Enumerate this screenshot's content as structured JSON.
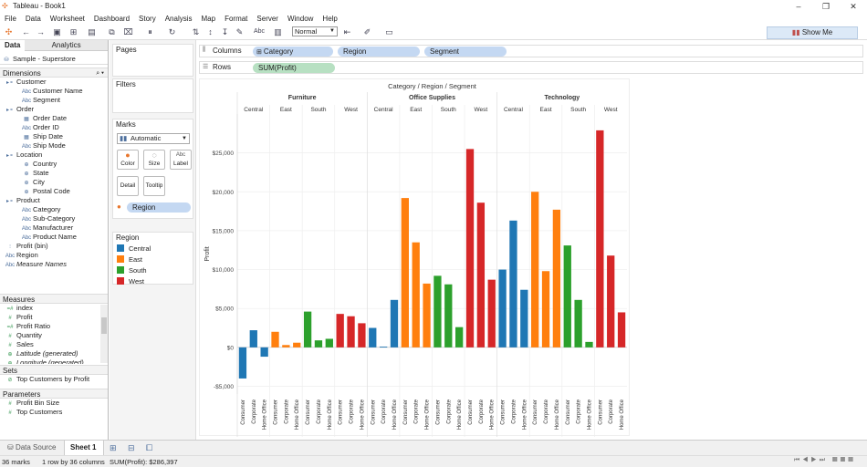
{
  "window": {
    "title": "Tableau - Book1"
  },
  "menu": [
    "File",
    "Data",
    "Worksheet",
    "Dashboard",
    "Story",
    "Analysis",
    "Map",
    "Format",
    "Server",
    "Window",
    "Help"
  ],
  "toolbar": {
    "format_select": "Normal",
    "show_me": "Show Me"
  },
  "left_pane": {
    "tabs": [
      "Data",
      "Analytics"
    ],
    "datasource": "Sample - Superstore",
    "dimensions_title": "Dimensions",
    "dimensions": [
      {
        "label": "Customer",
        "type": "folder",
        "indent": 0
      },
      {
        "label": "Customer Name",
        "type": "Abc",
        "indent": 1
      },
      {
        "label": "Segment",
        "type": "Abc",
        "indent": 1
      },
      {
        "label": "Order",
        "type": "folder",
        "indent": 0
      },
      {
        "label": "Order Date",
        "type": "date",
        "indent": 1
      },
      {
        "label": "Order ID",
        "type": "Abc",
        "indent": 1
      },
      {
        "label": "Ship Date",
        "type": "date",
        "indent": 1
      },
      {
        "label": "Ship Mode",
        "type": "Abc",
        "indent": 1
      },
      {
        "label": "Location",
        "type": "folder",
        "indent": 0
      },
      {
        "label": "Country",
        "type": "geo",
        "indent": 1
      },
      {
        "label": "State",
        "type": "geo",
        "indent": 1
      },
      {
        "label": "City",
        "type": "geo",
        "indent": 1
      },
      {
        "label": "Postal Code",
        "type": "geo",
        "indent": 1
      },
      {
        "label": "Product",
        "type": "folder",
        "indent": 0
      },
      {
        "label": "Category",
        "type": "Abc",
        "indent": 1
      },
      {
        "label": "Sub-Category",
        "type": "Abc",
        "indent": 1
      },
      {
        "label": "Manufacturer",
        "type": "Abc",
        "indent": 1
      },
      {
        "label": "Product Name",
        "type": "Abc",
        "indent": 1
      },
      {
        "label": "Profit (bin)",
        "type": "bin",
        "indent": 0
      },
      {
        "label": "Region",
        "type": "Abc",
        "indent": 0
      },
      {
        "label": "Measure Names",
        "type": "Abc",
        "indent": 0,
        "italic": true
      }
    ],
    "measures_title": "Measures",
    "measures": [
      {
        "label": "index",
        "type": "=#"
      },
      {
        "label": "Profit",
        "type": "#"
      },
      {
        "label": "Profit Ratio",
        "type": "=#"
      },
      {
        "label": "Quantity",
        "type": "#"
      },
      {
        "label": "Sales",
        "type": "#"
      },
      {
        "label": "Latitude (generated)",
        "type": "geo",
        "italic": true
      },
      {
        "label": "Longitude (generated)",
        "type": "geo",
        "italic": true
      }
    ],
    "sets_title": "Sets",
    "sets": [
      "Top Customers by Profit"
    ],
    "parameters_title": "Parameters",
    "parameters": [
      "Profit Bin Size",
      "Top Customers"
    ]
  },
  "cards": {
    "pages": "Pages",
    "filters": "Filters",
    "marks": "Marks",
    "mark_type": "Automatic",
    "mark_buttons": [
      "Color",
      "Size",
      "Label",
      "Detail",
      "Tooltip"
    ],
    "color_pill": "Region"
  },
  "shelves": {
    "columns_label": "Columns",
    "columns": [
      "Category",
      "Region",
      "Segment"
    ],
    "rows_label": "Rows",
    "rows": [
      "SUM(Profit)"
    ]
  },
  "legend": {
    "title": "Region",
    "items": [
      {
        "label": "Central",
        "color": "#1f77b4"
      },
      {
        "label": "East",
        "color": "#ff7f0e"
      },
      {
        "label": "South",
        "color": "#2ca02c"
      },
      {
        "label": "West",
        "color": "#d62728"
      }
    ]
  },
  "chart_data": {
    "type": "bar",
    "title": "Category / Region / Segment",
    "ylabel": "Profit",
    "ylim": [
      -6000,
      30000
    ],
    "yticks": [
      -5000,
      0,
      5000,
      10000,
      15000,
      20000,
      25000
    ],
    "ytick_labels": [
      "-$5,000",
      "$0",
      "$5,000",
      "$10,000",
      "$15,000",
      "$20,000",
      "$25,000"
    ],
    "categories": [
      "Furniture",
      "Office Supplies",
      "Technology"
    ],
    "regions": [
      "Central",
      "East",
      "South",
      "West"
    ],
    "segments": [
      "Consumer",
      "Corporate",
      "Home Office"
    ],
    "region_colors": {
      "Central": "#1f77b4",
      "East": "#ff7f0e",
      "South": "#2ca02c",
      "West": "#d62728"
    },
    "values": {
      "Furniture": {
        "Central": [
          -4000,
          2200,
          -1200
        ],
        "East": [
          2000,
          300,
          600
        ],
        "South": [
          4600,
          900,
          1100
        ],
        "West": [
          4300,
          4000,
          3100
        ]
      },
      "Office Supplies": {
        "Central": [
          2500,
          100,
          6100
        ],
        "East": [
          19200,
          13500,
          8200
        ],
        "South": [
          9200,
          8100,
          2600
        ],
        "West": [
          25500,
          18600,
          8700
        ]
      },
      "Technology": {
        "Central": [
          10000,
          16300,
          7400
        ],
        "East": [
          20000,
          9800,
          17700
        ],
        "South": [
          13100,
          6100,
          700
        ],
        "West": [
          27900,
          11800,
          4500
        ]
      }
    }
  },
  "bottom": {
    "datasource_tab": "Data Source",
    "sheet_tab": "Sheet 1"
  },
  "status": {
    "marks": "36 marks",
    "shape": "1 row by 36 columns",
    "sum": "SUM(Profit): $286,397"
  }
}
